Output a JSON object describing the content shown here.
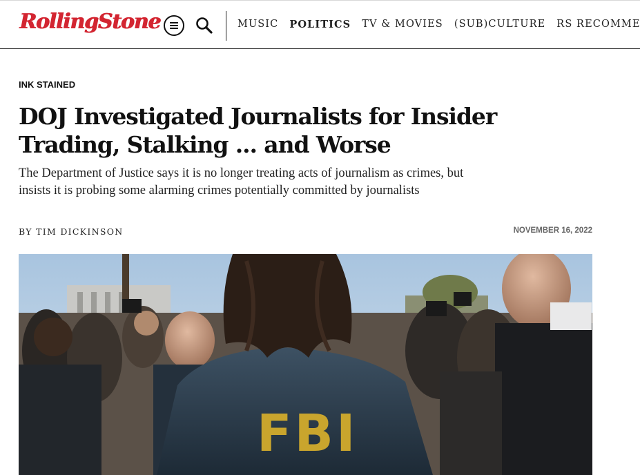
{
  "header": {
    "logo_text": "RollingStone",
    "brand_color": "#d32531",
    "menu_icon": "hamburger-menu-icon",
    "search_icon": "search-icon",
    "nav": [
      {
        "label": "MUSIC"
      },
      {
        "label": "POLITICS",
        "active": true
      },
      {
        "label": "TV & MOVIES"
      },
      {
        "label": "(SUB)CULTURE"
      },
      {
        "label": "RS RECOMMENDS"
      }
    ]
  },
  "article": {
    "kicker": "INK STAINED",
    "headline": "DOJ Investigated Journalists for Insider Trading, Stalking ... and Worse",
    "dek": "The Department of Justice says it is no longer treating acts of journalism as crimes, but insists it is probing some alarming crimes potentially committed by journalists",
    "byline_prefix": "BY ",
    "author": "TIM DICKINSON",
    "date": "NOVEMBER 16, 2022",
    "hero_image": "Photo of FBI agent in jacket facing press crowd and cameras outdoors",
    "hero_jacket_text": "FBI"
  }
}
